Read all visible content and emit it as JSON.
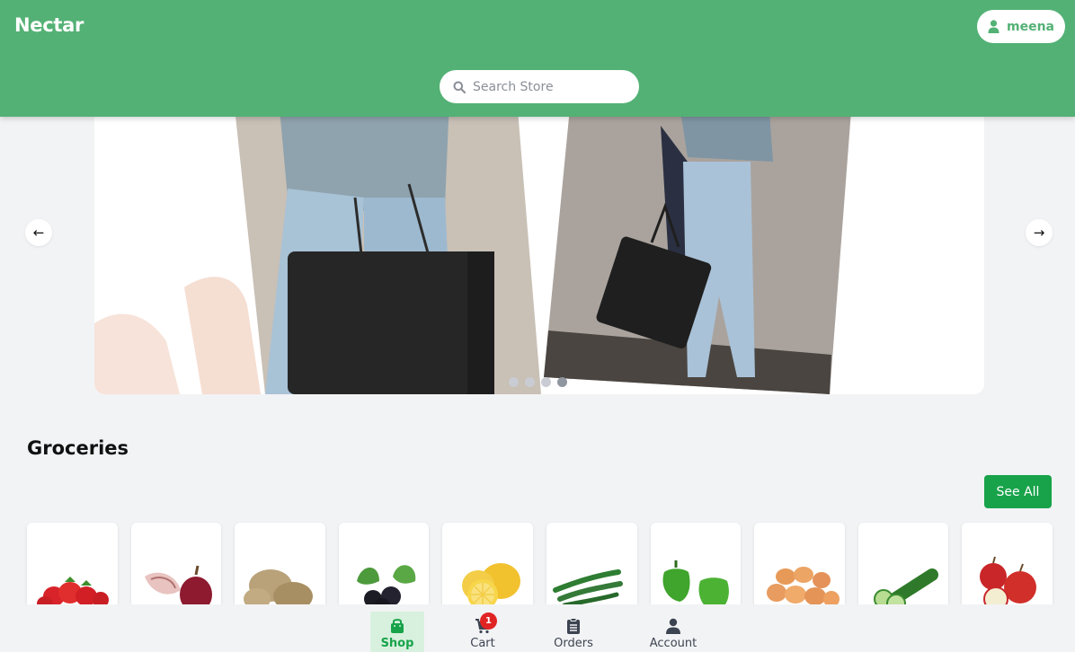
{
  "header": {
    "brand": "Nectar",
    "user_name": "meena",
    "search_placeholder": "Search Store",
    "colors": {
      "header_bg": "#53b175",
      "accent": "#18a34a"
    }
  },
  "carousel": {
    "prev_icon": "arrow-left-icon",
    "next_icon": "arrow-right-icon",
    "slide_count": 4,
    "active_slide": 4,
    "prev_glyph": "←",
    "next_glyph": "→"
  },
  "groceries": {
    "title": "Groceries",
    "see_all_label": "See All",
    "products": [
      {
        "icon": "strawberries-icon"
      },
      {
        "icon": "red-onion-icon"
      },
      {
        "icon": "potatoes-icon"
      },
      {
        "icon": "blackberries-icon"
      },
      {
        "icon": "lemons-icon"
      },
      {
        "icon": "green-chilies-icon"
      },
      {
        "icon": "green-bell-peppers-icon"
      },
      {
        "icon": "eggs-icon"
      },
      {
        "icon": "cucumber-icon"
      },
      {
        "icon": "apples-icon"
      }
    ]
  },
  "bottom_nav": {
    "items": [
      {
        "label": "Shop",
        "icon": "shopping-bag-icon",
        "active": true
      },
      {
        "label": "Cart",
        "icon": "cart-icon",
        "badge": "1"
      },
      {
        "label": "Orders",
        "icon": "clipboard-icon"
      },
      {
        "label": "Account",
        "icon": "user-icon"
      }
    ]
  }
}
